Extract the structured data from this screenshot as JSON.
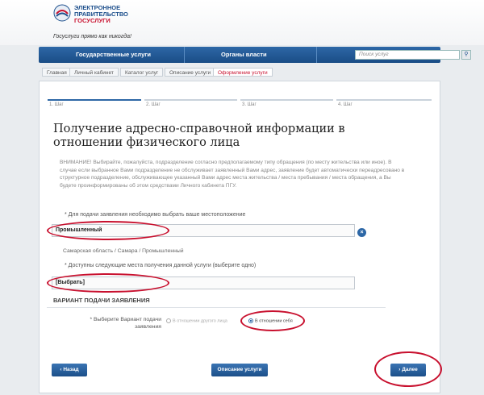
{
  "header": {
    "logo_line1": "ЭЛЕКТРОННОЕ",
    "logo_line2": "ПРАВИТЕЛЬСТВО",
    "logo_line3": "ГОСУСЛУГИ",
    "slogan": "Госуслуги прямо как никогда!"
  },
  "nav": {
    "items": [
      "Государственные услуги",
      "Органы власти"
    ],
    "search_placeholder": "Поиск услуг"
  },
  "breadcrumbs": [
    "Главная",
    "Личный кабинет",
    "Каталог услуг",
    "Описание услуги",
    "Оформление услуги"
  ],
  "steps": [
    "1. Шаг",
    "2. Шаг",
    "3. Шаг",
    "4. Шаг"
  ],
  "page": {
    "title": "Получение адресно-справочной информации в отношении физического лица",
    "warning": "ВНИМАНИЕ! Выбирайте, пожалуйста, подразделение согласно предполагаемому типу обращения (по месту жительства или иное). В случае если выбранное Вами подразделение не обслуживает заявленный Вами адрес, заявление будет автоматически переадресовано в структурное подразделение, обслуживающее указанный Вами адрес места жительства / места пребывания / места обращения, а Вы будете проинформированы об этом средствами Личного кабинета ПГУ.",
    "location_label": "* Для подачи заявления необходимо выбрать ваше местоположение",
    "location_value": "Промышленный",
    "location_path": "Самарская область / Самара / Промышленный",
    "places_label": "* Доступны следующие места получения данной услуги (выберите одно)",
    "places_value": "[Выбрать]",
    "section_title": "ВАРИАНТ ПОДАЧИ ЗАЯВЛЕНИЯ",
    "variant_label": "* Выберите Вариант подачи заявления",
    "option_other": "В отношении другого лица",
    "option_self": "В отношении себя"
  },
  "buttons": {
    "back": "Назад",
    "description": "Описание услуги",
    "next": "Далее"
  },
  "colors": {
    "accent": "#1c4f89",
    "annotation": "#c8102e"
  }
}
